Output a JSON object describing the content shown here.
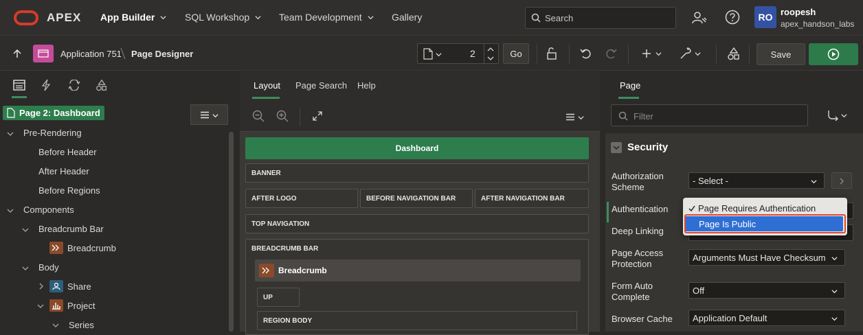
{
  "topbar": {
    "logo": "APEX",
    "nav": [
      "App Builder",
      "SQL Workshop",
      "Team Development",
      "Gallery"
    ],
    "search_placeholder": "Search",
    "user_initials": "RO",
    "user_name": "roopesh",
    "workspace": "apex_handson_labs"
  },
  "toolbar": {
    "app_label": "Application 751",
    "page_designer": "Page Designer",
    "page_number": "2",
    "go_label": "Go",
    "save_label": "Save"
  },
  "left_panel": {
    "page_node": "Page 2: Dashboard",
    "tree": {
      "pre_rendering": "Pre-Rendering",
      "before_header": "Before Header",
      "after_header": "After Header",
      "before_regions": "Before Regions",
      "components": "Components",
      "breadcrumb_bar": "Breadcrumb Bar",
      "breadcrumb": "Breadcrumb",
      "body": "Body",
      "share": "Share",
      "project": "Project",
      "series": "Series"
    }
  },
  "middle_panel": {
    "tabs": [
      "Layout",
      "Page Search",
      "Help"
    ],
    "page_title": "Dashboard",
    "slots": {
      "banner": "BANNER",
      "after_logo": "AFTER LOGO",
      "before_nav_bar": "BEFORE NAVIGATION BAR",
      "after_nav_bar": "AFTER NAVIGATION BAR",
      "top_navigation": "TOP NAVIGATION",
      "breadcrumb_bar": "BREADCRUMB BAR",
      "breadcrumb_region": "Breadcrumb",
      "up": "UP",
      "region_body": "REGION BODY"
    }
  },
  "right_panel": {
    "tab": "Page",
    "filter_placeholder": "Filter",
    "section": "Security",
    "properties": {
      "authorization_scheme_label": "Authorization Scheme",
      "authorization_scheme_value": "- Select -",
      "authentication_label": "Authentication",
      "deep_linking_label": "Deep Linking",
      "page_access_label": "Page Access Protection",
      "page_access_value": "Arguments Must Have Checksum",
      "form_auto_label": "Form Auto Complete",
      "form_auto_value": "Off",
      "browser_cache_label": "Browser Cache",
      "browser_cache_value": "Application Default"
    },
    "dropdown_options": [
      "Page Requires Authentication",
      "Page Is Public"
    ]
  }
}
